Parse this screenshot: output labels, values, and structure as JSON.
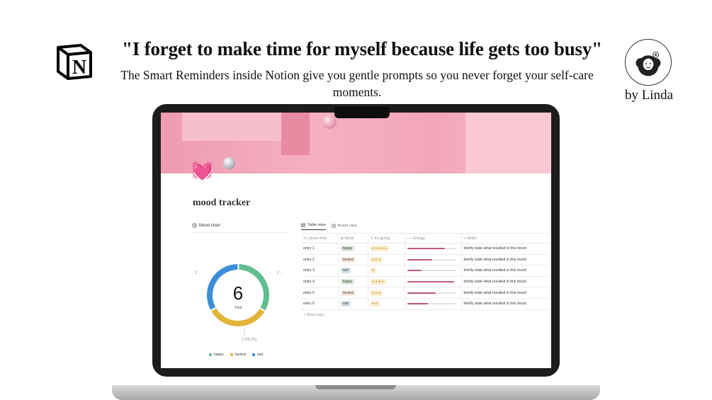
{
  "header": {
    "headline": "\"I forget to make time for myself because life gets too busy\"",
    "subline": "The Smart Reminders inside Notion give you gentle prompts so you never forget your self-care moments.",
    "author": "by Linda",
    "logo_icon": "notion-logo-icon",
    "avatar_icon": "illustrated-avatar-icon"
  },
  "page": {
    "icon": "💓",
    "title": "mood tracker"
  },
  "chart": {
    "title": "Mood chart",
    "total_value": "6",
    "total_label": "Total",
    "label_left": "2 ...",
    "label_right": "2 ...",
    "label_bottom": "2 (33.3%)"
  },
  "chart_data": {
    "type": "pie",
    "title": "Mood chart",
    "categories": [
      "happy",
      "neutral",
      "sad"
    ],
    "values": [
      2,
      2,
      2
    ],
    "colors": [
      "#5fbf8f",
      "#e2b43a",
      "#3d8fd9"
    ],
    "legend": "bottom"
  },
  "tabs": [
    {
      "label": "Table view",
      "icon": "table-icon",
      "active": true
    },
    {
      "label": "Board view",
      "icon": "board-icon",
      "active": false
    }
  ],
  "columns": [
    "Quick entry",
    "Mood",
    "It's giving",
    "Energy",
    "Notes"
  ],
  "rows": [
    {
      "entry": "entry 1",
      "mood": "happy",
      "stars": 5,
      "energy": 0.78,
      "notes": "briefly state what resulted in this mood"
    },
    {
      "entry": "entry 2",
      "mood": "neutral",
      "stars": 3,
      "energy": 0.52,
      "notes": "briefly state what resulted in this mood"
    },
    {
      "entry": "entry 3",
      "mood": "sad",
      "stars": 1,
      "energy": 0.3,
      "notes": "briefly state what resulted in this mood"
    },
    {
      "entry": "entry 4",
      "mood": "happy",
      "stars": 4,
      "energy": 0.98,
      "notes": "briefly state what resulted in this mood"
    },
    {
      "entry": "entry 5",
      "mood": "neutral",
      "stars": 3,
      "energy": 0.6,
      "notes": "briefly state what resulted in this mood"
    },
    {
      "entry": "entry 6",
      "mood": "sad",
      "stars": 2,
      "energy": 0.43,
      "notes": "briefly state what resulted in this mood"
    }
  ],
  "mood_colors": {
    "happy": "#dbeddb",
    "neutral": "#fbecdd",
    "sad": "#d3e5ef"
  },
  "new_page_label": "New page"
}
